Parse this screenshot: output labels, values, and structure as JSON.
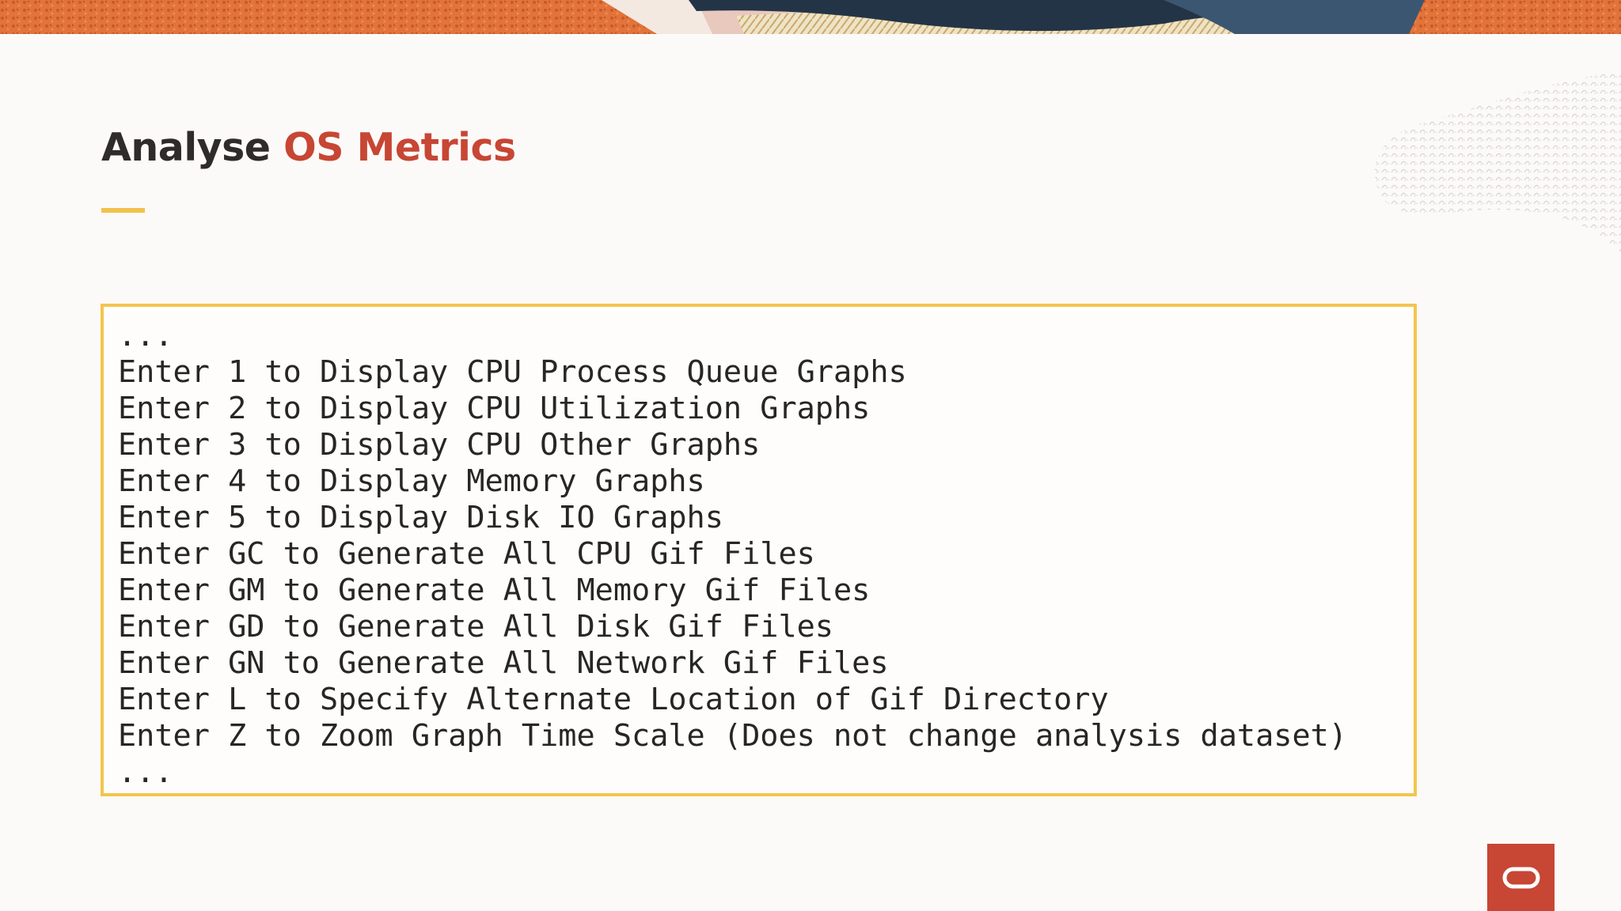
{
  "slide": {
    "title_plain": "Analyse ",
    "title_accent": "OS Metrics"
  },
  "code_block": {
    "lines": [
      "...",
      "Enter 1 to Display CPU Process Queue Graphs",
      "Enter 2 to Display CPU Utilization Graphs",
      "Enter 3 to Display CPU Other Graphs",
      "Enter 4 to Display Memory Graphs",
      "Enter 5 to Display Disk IO Graphs",
      "Enter GC to Generate All CPU Gif Files",
      "Enter GM to Generate All Memory Gif Files",
      "Enter GD to Generate All Disk Gif Files",
      "Enter GN to Generate All Network Gif Files",
      "Enter L to Specify Alternate Location of Gif Directory",
      "Enter Z to Zoom Graph Time Scale (Does not change analysis dataset)",
      "..."
    ]
  },
  "logo": {
    "icon": "oracle-logo-icon"
  },
  "colors": {
    "accent": "#c74634",
    "rule": "#f0c24a",
    "box_border": "#f2c54e",
    "background": "#fcfaf8"
  }
}
